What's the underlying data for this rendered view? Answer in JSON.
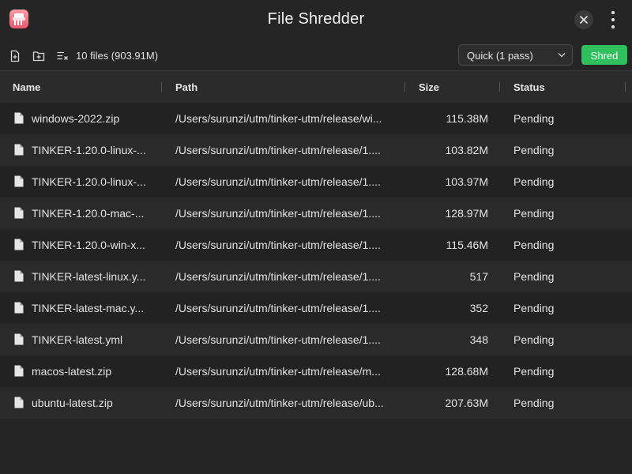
{
  "app": {
    "title": "File Shredder"
  },
  "toolbar": {
    "file_count": "10 files (903.91M)",
    "mode": "Quick (1 pass)",
    "shred_label": "Shred"
  },
  "colors": {
    "accent": "#2fbf5c",
    "background": "#252525"
  },
  "table": {
    "headers": {
      "name": "Name",
      "path": "Path",
      "size": "Size",
      "status": "Status"
    },
    "rows": [
      {
        "name": "windows-2022.zip",
        "path": "/Users/surunzi/utm/tinker-utm/release/wi...",
        "size": "115.38M",
        "status": "Pending"
      },
      {
        "name": "TINKER-1.20.0-linux-...",
        "path": "/Users/surunzi/utm/tinker-utm/release/1....",
        "size": "103.82M",
        "status": "Pending"
      },
      {
        "name": "TINKER-1.20.0-linux-...",
        "path": "/Users/surunzi/utm/tinker-utm/release/1....",
        "size": "103.97M",
        "status": "Pending"
      },
      {
        "name": "TINKER-1.20.0-mac-...",
        "path": "/Users/surunzi/utm/tinker-utm/release/1....",
        "size": "128.97M",
        "status": "Pending"
      },
      {
        "name": "TINKER-1.20.0-win-x...",
        "path": "/Users/surunzi/utm/tinker-utm/release/1....",
        "size": "115.46M",
        "status": "Pending"
      },
      {
        "name": "TINKER-latest-linux.y...",
        "path": "/Users/surunzi/utm/tinker-utm/release/1....",
        "size": "517",
        "status": "Pending"
      },
      {
        "name": "TINKER-latest-mac.y...",
        "path": "/Users/surunzi/utm/tinker-utm/release/1....",
        "size": "352",
        "status": "Pending"
      },
      {
        "name": "TINKER-latest.yml",
        "path": "/Users/surunzi/utm/tinker-utm/release/1....",
        "size": "348",
        "status": "Pending"
      },
      {
        "name": "macos-latest.zip",
        "path": "/Users/surunzi/utm/tinker-utm/release/m...",
        "size": "128.68M",
        "status": "Pending"
      },
      {
        "name": "ubuntu-latest.zip",
        "path": "/Users/surunzi/utm/tinker-utm/release/ub...",
        "size": "207.63M",
        "status": "Pending"
      }
    ]
  }
}
